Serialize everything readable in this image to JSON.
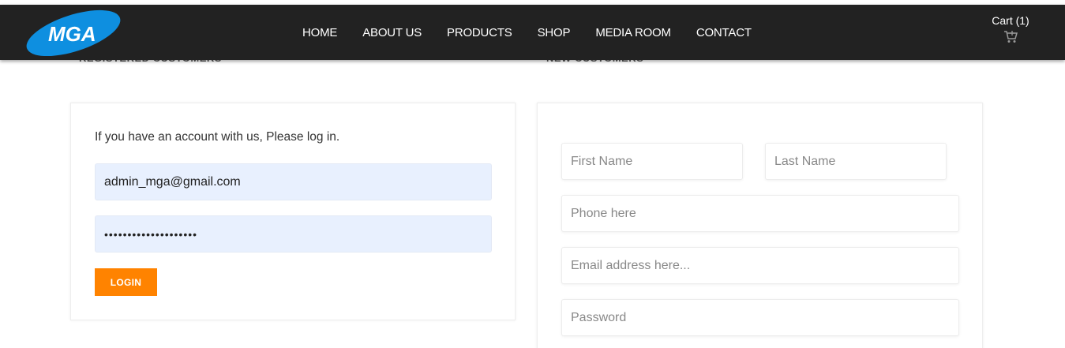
{
  "header": {
    "logo_text": "MGA",
    "nav": [
      "HOME",
      "ABOUT US",
      "PRODUCTS",
      "SHOP",
      "MEDIA ROOM",
      "CONTACT"
    ],
    "cart_label": "Cart (1)"
  },
  "sections": {
    "registered_heading": "REGISTERED CUSTOMERS",
    "new_heading": "NEW CUSTOMERS"
  },
  "login": {
    "intro": "If you have an account with us, Please log in.",
    "email_value": "admin_mga@gmail.com",
    "password_masked": "••••••••••••••••••••",
    "button_label": "LOGIN"
  },
  "register": {
    "first_name_placeholder": "First Name",
    "last_name_placeholder": "Last Name",
    "phone_placeholder": "Phone here",
    "email_placeholder": "Email address here...",
    "password_placeholder": "Password"
  },
  "colors": {
    "navbar": "#222222",
    "accent": "#ff8300",
    "logo_blue": "#0e8fe0",
    "autofill": "#e8f0fe"
  }
}
